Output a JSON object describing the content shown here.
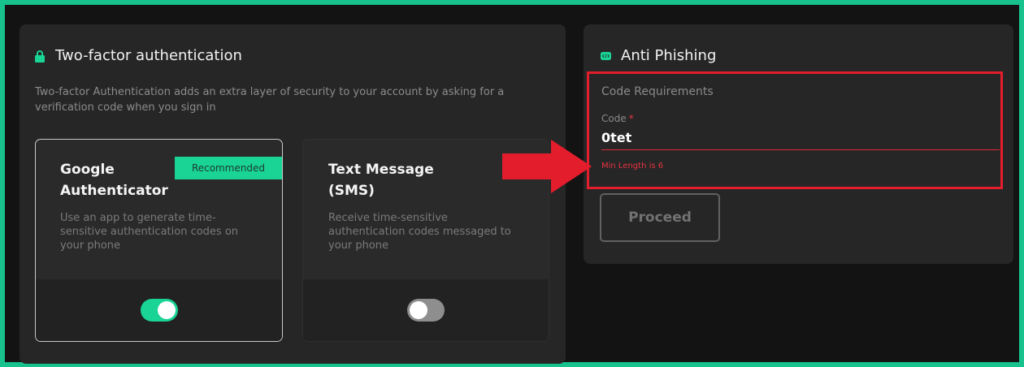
{
  "two_factor": {
    "title": "Two-factor authentication",
    "description": "Two-factor Authentication adds an extra layer of security to your account by asking for a verification code when you sign in",
    "lock_icon": "lock-icon",
    "methods": [
      {
        "name": "Google Authenticator",
        "badge": "Recommended",
        "description": "Use an app to generate time-sensitive authentication codes on your phone",
        "enabled": true
      },
      {
        "name": "Text Message (SMS)",
        "description": "Receive time-sensitive authentication codes messaged to your phone",
        "enabled": false
      }
    ]
  },
  "anti_phishing": {
    "title": "Anti Phishing",
    "icon": "shield-icon",
    "requirements_label": "Code Requirements",
    "code_label": "Code",
    "required_marker": "*",
    "code_value": "0tet",
    "error_message": "Min Length is 6",
    "proceed_label": "Proceed"
  },
  "colors": {
    "accent": "#19d495",
    "frame_border": "#17c28d",
    "error": "#e8343f",
    "annotation": "#e41d2c"
  }
}
